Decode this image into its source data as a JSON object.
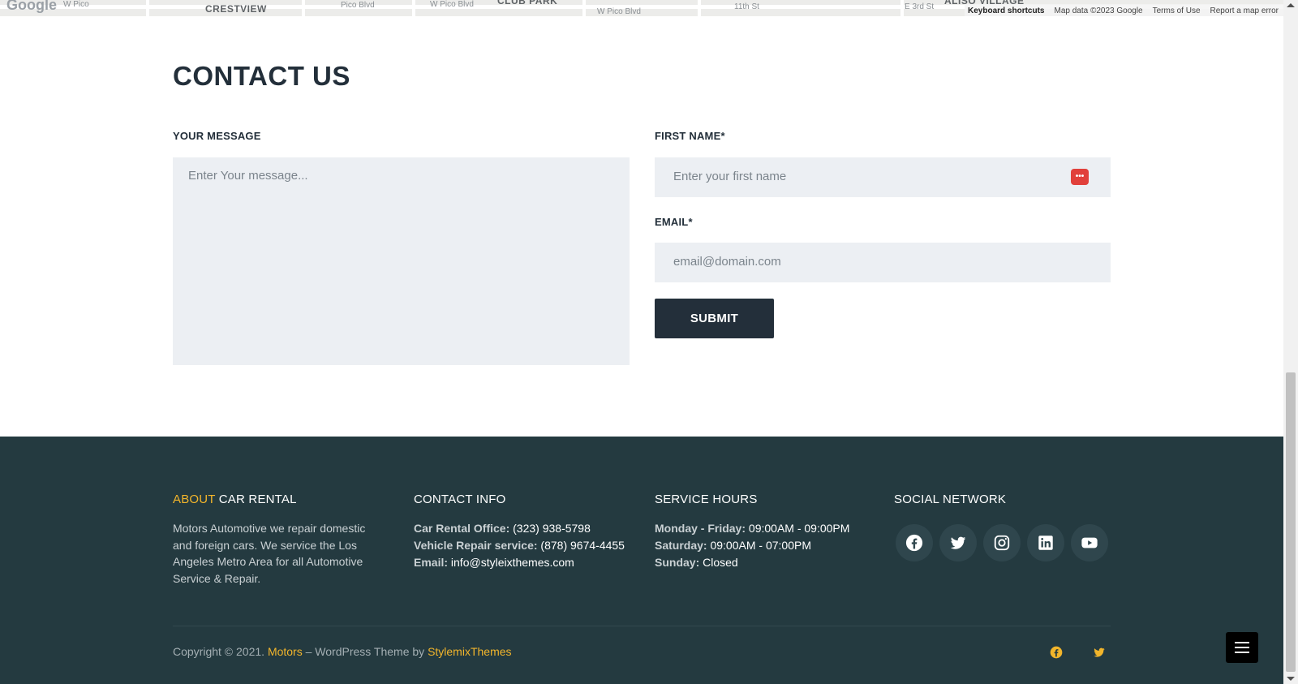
{
  "map": {
    "logo": "Google",
    "labels": [
      "CRESTVIEW",
      "W Pico",
      "Pico Blvd",
      "W Pico Blvd",
      "CLUB PARK",
      "W Pico Blvd",
      "11th St",
      "E 3rd St",
      "ALISO VILLAGE"
    ],
    "attribution": {
      "keyboard": "Keyboard shortcuts",
      "data": "Map data ©2023 Google",
      "terms": "Terms of Use",
      "report": "Report a map error"
    }
  },
  "contact": {
    "title": "CONTACT US",
    "message_label": "YOUR MESSAGE",
    "message_placeholder": "Enter Your message...",
    "first_name_label": "FIRST NAME*",
    "first_name_placeholder": "Enter your first name",
    "email_label": "EMAIL*",
    "email_placeholder": "email@domain.com",
    "submit_label": "SUBMIT",
    "autofill_icon": "password-manager-icon"
  },
  "footer": {
    "about": {
      "heading_accent": "ABOUT",
      "heading_rest": " CAR RENTAL",
      "text": "Motors Automotive we repair domestic and foreign cars. We service the Los Angeles Metro Area for all Automotive Service & Repair."
    },
    "contact_info": {
      "heading": "CONTACT INFO",
      "lines": [
        {
          "label": "Car Rental Office:",
          "value": " (323) 938-5798"
        },
        {
          "label": "Vehicle Repair service:",
          "value": " (878) 9674-4455"
        },
        {
          "label": "Email:",
          "value": " info@styleixthemes.com"
        }
      ]
    },
    "service_hours": {
      "heading": "SERVICE HOURS",
      "lines": [
        {
          "label": "Monday - Friday:",
          "value": " 09:00AM - 09:00PM"
        },
        {
          "label": "Saturday:",
          "value": " 09:00AM - 07:00PM"
        },
        {
          "label": "Sunday:",
          "value": " Closed"
        }
      ]
    },
    "social": {
      "heading": "SOCIAL NETWORK",
      "icons": [
        "facebook-icon",
        "twitter-icon",
        "instagram-icon",
        "linkedin-icon",
        "youtube-icon"
      ]
    },
    "copyright": {
      "prefix": "Copyright © 2021. ",
      "brand": "Motors",
      "middle": " – WordPress Theme by ",
      "author": "StylemixThemes"
    },
    "bottom_icons": [
      "facebook-icon",
      "twitter-icon"
    ],
    "menu_icon": "hamburger-menu-icon"
  },
  "colors": {
    "accent": "#f2b52b",
    "footer_bg": "#243a40",
    "dark_text": "#232f3a",
    "input_bg": "#eceff3"
  }
}
